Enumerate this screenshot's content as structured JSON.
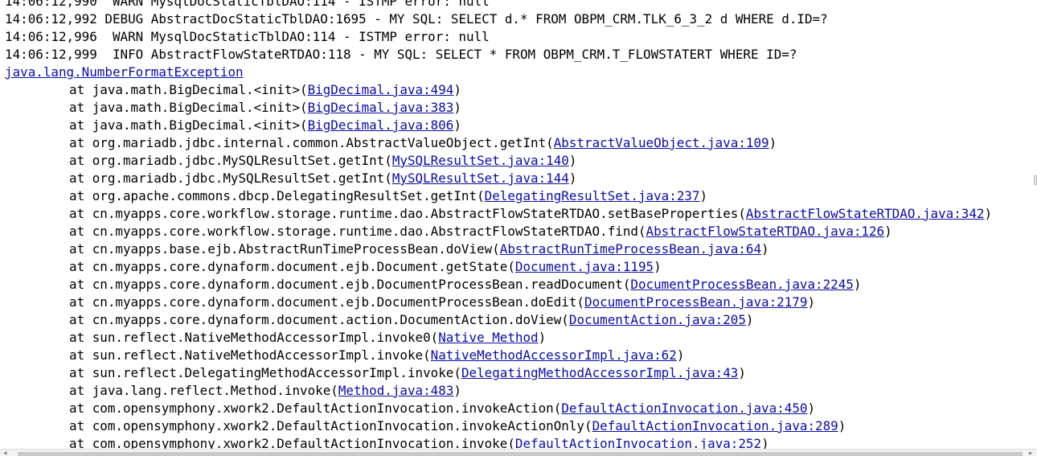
{
  "console": {
    "lines": [
      {
        "type": "log",
        "text": "14:06:12,990  WARN MysqlDocStaticTblDAO:114 - ISTMP error: null"
      },
      {
        "type": "log",
        "text": "14:06:12,992 DEBUG AbstractDocStaticTblDAO:1695 - MY SQL: SELECT d.* FROM OBPM_CRM.TLK_6_3_2 d WHERE d.ID=?"
      },
      {
        "type": "log",
        "text": "14:06:12,996  WARN MysqlDocStaticTblDAO:114 - ISTMP error: null"
      },
      {
        "type": "log",
        "text": "14:06:12,999  INFO AbstractFlowStateRTDAO:118 - MY SQL: SELECT * FROM OBPM_CRM.T_FLOWSTATERT WHERE ID=?"
      },
      {
        "type": "exception",
        "text": "java.lang.NumberFormatException"
      },
      {
        "type": "trace",
        "method": "at java.math.BigDecimal.<init>",
        "location": "BigDecimal.java:494"
      },
      {
        "type": "trace",
        "method": "at java.math.BigDecimal.<init>",
        "location": "BigDecimal.java:383"
      },
      {
        "type": "trace",
        "method": "at java.math.BigDecimal.<init>",
        "location": "BigDecimal.java:806"
      },
      {
        "type": "trace",
        "method": "at org.mariadb.jdbc.internal.common.AbstractValueObject.getInt",
        "location": "AbstractValueObject.java:109"
      },
      {
        "type": "trace",
        "method": "at org.mariadb.jdbc.MySQLResultSet.getInt",
        "location": "MySQLResultSet.java:140"
      },
      {
        "type": "trace",
        "method": "at org.mariadb.jdbc.MySQLResultSet.getInt",
        "location": "MySQLResultSet.java:144"
      },
      {
        "type": "trace",
        "method": "at org.apache.commons.dbcp.DelegatingResultSet.getInt",
        "location": "DelegatingResultSet.java:237"
      },
      {
        "type": "trace",
        "method": "at cn.myapps.core.workflow.storage.runtime.dao.AbstractFlowStateRTDAO.setBaseProperties",
        "location": "AbstractFlowStateRTDAO.java:342"
      },
      {
        "type": "trace",
        "method": "at cn.myapps.core.workflow.storage.runtime.dao.AbstractFlowStateRTDAO.find",
        "location": "AbstractFlowStateRTDAO.java:126"
      },
      {
        "type": "trace",
        "method": "at cn.myapps.base.ejb.AbstractRunTimeProcessBean.doView",
        "location": "AbstractRunTimeProcessBean.java:64"
      },
      {
        "type": "trace",
        "method": "at cn.myapps.core.dynaform.document.ejb.Document.getState",
        "location": "Document.java:1195"
      },
      {
        "type": "trace",
        "method": "at cn.myapps.core.dynaform.document.ejb.DocumentProcessBean.readDocument",
        "location": "DocumentProcessBean.java:2245"
      },
      {
        "type": "trace",
        "method": "at cn.myapps.core.dynaform.document.ejb.DocumentProcessBean.doEdit",
        "location": "DocumentProcessBean.java:2179"
      },
      {
        "type": "trace",
        "method": "at cn.myapps.core.dynaform.document.action.DocumentAction.doView",
        "location": "DocumentAction.java:205"
      },
      {
        "type": "trace",
        "method": "at sun.reflect.NativeMethodAccessorImpl.invoke0",
        "location": "Native Method"
      },
      {
        "type": "trace",
        "method": "at sun.reflect.NativeMethodAccessorImpl.invoke",
        "location": "NativeMethodAccessorImpl.java:62"
      },
      {
        "type": "trace",
        "method": "at sun.reflect.DelegatingMethodAccessorImpl.invoke",
        "location": "DelegatingMethodAccessorImpl.java:43"
      },
      {
        "type": "trace",
        "method": "at java.lang.reflect.Method.invoke",
        "location": "Method.java:483"
      },
      {
        "type": "trace",
        "method": "at com.opensymphony.xwork2.DefaultActionInvocation.invokeAction",
        "location": "DefaultActionInvocation.java:450"
      },
      {
        "type": "trace",
        "method": "at com.opensymphony.xwork2.DefaultActionInvocation.invokeActionOnly",
        "location": "DefaultActionInvocation.java:289"
      },
      {
        "type": "trace",
        "method": "at com.opensymphony.xwork2.DefaultActionInvocation.invoke",
        "location": "DefaultActionInvocation.java:252"
      }
    ]
  },
  "colors": {
    "text": "#000000",
    "link": "#0b0ba8",
    "background": "#ffffff"
  }
}
